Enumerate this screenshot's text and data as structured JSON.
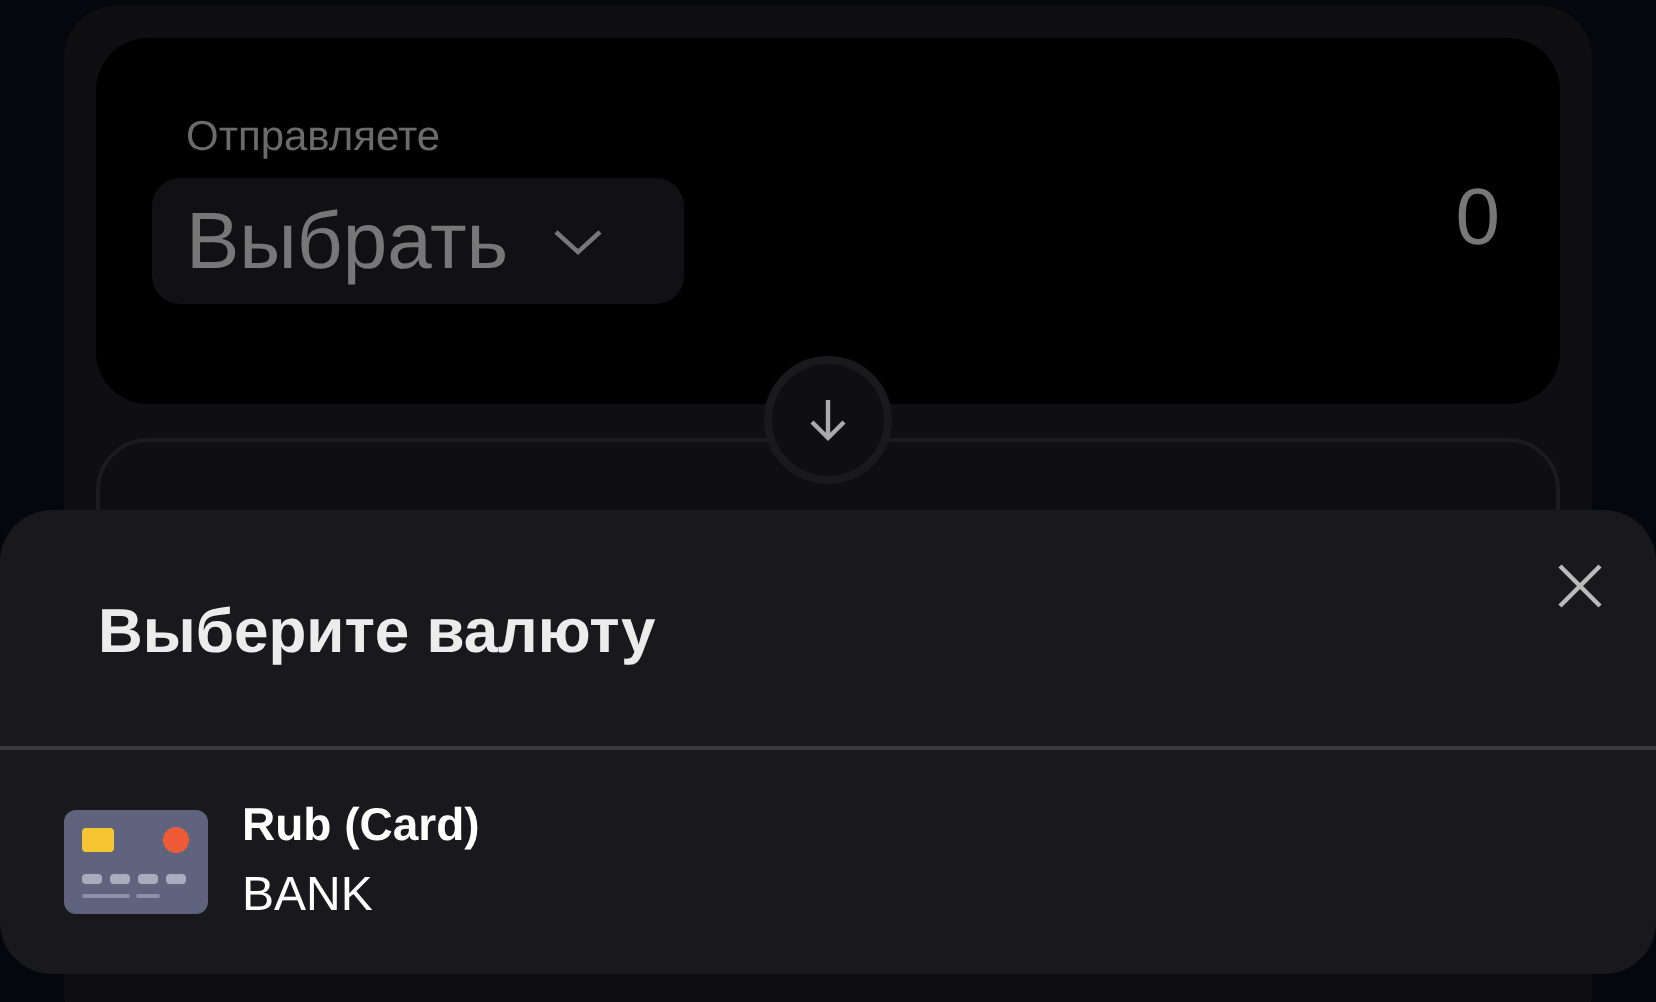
{
  "send": {
    "label": "Отправляете",
    "select": "Выбрать",
    "amount": "0"
  },
  "sheet": {
    "title": "Выберите валюту",
    "items": [
      {
        "name": "Rub (Card)",
        "type": "BANK",
        "kind": "card"
      }
    ]
  }
}
